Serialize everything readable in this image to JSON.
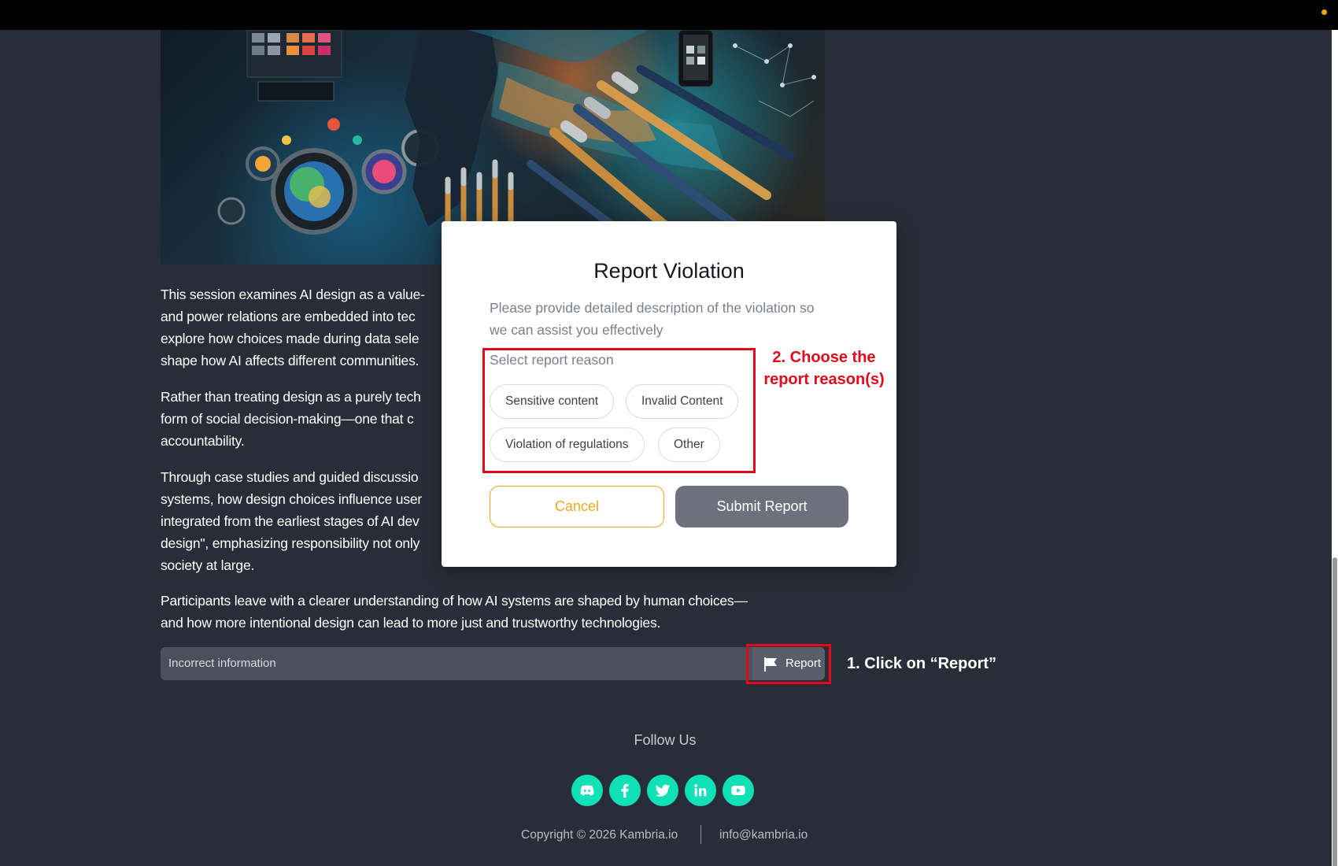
{
  "colors": {
    "page_background": "#282d37",
    "accent_orange": "#f5a524",
    "social_green": "#12e1b8",
    "annotation_red": "#e4091a",
    "submit_gray": "#6c717b"
  },
  "article": {
    "paragraphs": [
      "This session examines AI design as a value-\nand power relations are embedded into tec\nexplore how choices made during data sele\nshape how AI affects different communities.",
      "Rather than treating design as a purely tech\nform of social decision-making—one that c\naccountability.",
      "Through case studies and guided discussio\nsystems, how design choices influence user\nintegrated from the earliest stages of AI dev\ndesign\", emphasizing responsibility not only\nsociety at large.",
      "Participants leave with a clearer understanding of how AI systems are shaped by human choices—\nand how more intentional design can lead to more just and trustworthy technologies."
    ]
  },
  "report_bar": {
    "info_text": "Incorrect information",
    "report_label": "Report",
    "report_icon": "flag-icon"
  },
  "modal": {
    "title": "Report Violation",
    "description": "Please provide detailed description of the violation so\nwe can assist you effectively",
    "reason_label": "Select report reason",
    "reasons": [
      "Sensitive content",
      "Invalid Content",
      "Violation of regulations",
      "Other"
    ],
    "cancel_label": "Cancel",
    "submit_label": "Submit Report"
  },
  "annotations": {
    "step1": "1. Click on “Report”",
    "step2": "2. Choose the\nreport reason(s)"
  },
  "footer": {
    "follow_label": "Follow Us",
    "social_icons": [
      "discord-icon",
      "facebook-icon",
      "twitter-icon",
      "linkedin-icon",
      "youtube-icon"
    ],
    "copyright": "Copyright © 2026 Kambria.io",
    "email": "info@kambria.io"
  }
}
